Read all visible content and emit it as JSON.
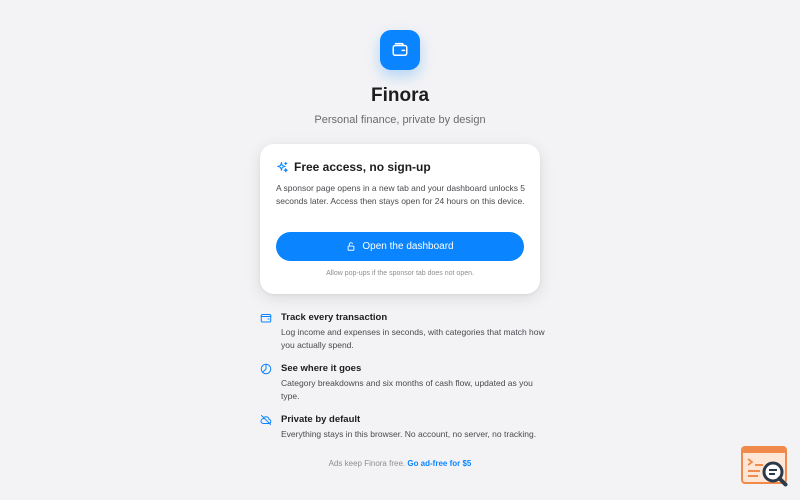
{
  "app": {
    "name": "Finora",
    "tagline": "Personal finance, private by design",
    "logo_icon": "wallet-icon",
    "accent": "#0a84ff"
  },
  "card": {
    "icon": "sparkles-icon",
    "title": "Free access, no sign-up",
    "body": "A sponsor page opens in a new tab and your dashboard unlocks 5 seconds later. Access then stays open for 24 hours on this device.",
    "button_icon": "unlock-icon",
    "button_label": "Open the dashboard",
    "note": "Allow pop-ups if the sponsor tab does not open."
  },
  "features": [
    {
      "icon": "wallet-icon",
      "title": "Track every transaction",
      "description": "Log income and expenses in seconds, with categories that match how you actually spend."
    },
    {
      "icon": "pie-chart-icon",
      "title": "See where it goes",
      "description": "Category breakdowns and six months of cash flow, updated as you type."
    },
    {
      "icon": "cloud-off-icon",
      "title": "Private by default",
      "description": "Everything stays in this browser. No account, no server, no tracking."
    }
  ],
  "footer": {
    "text": "Ads keep Finora free.",
    "link_label": "Go ad-free for $5"
  }
}
